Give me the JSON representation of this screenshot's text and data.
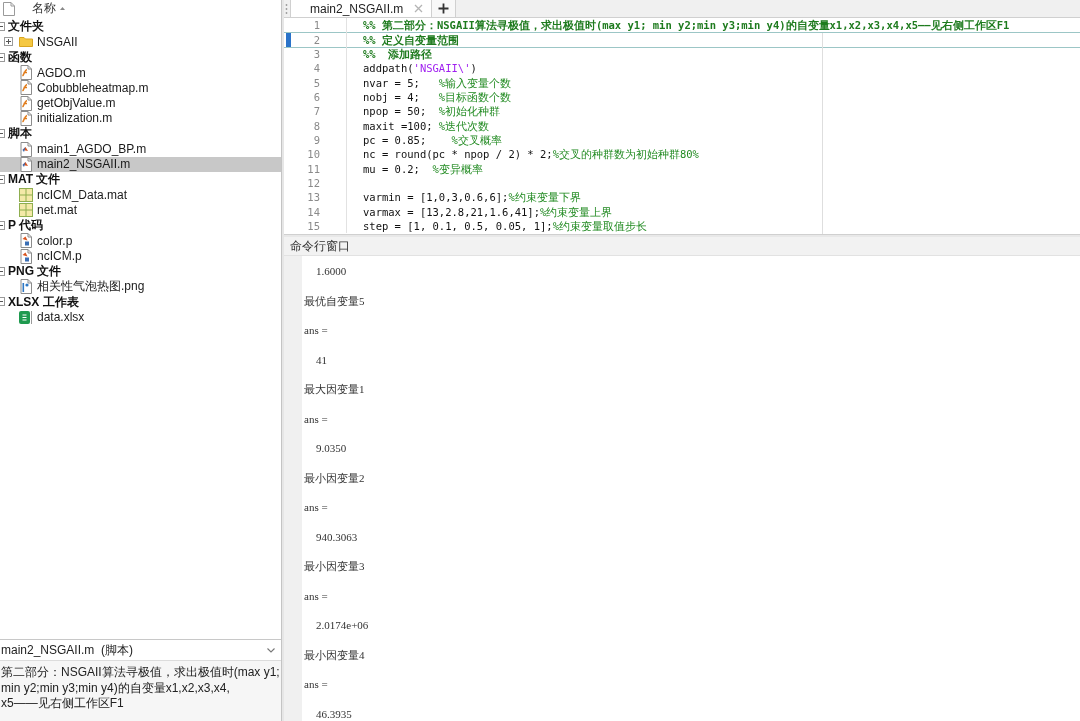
{
  "file_browser": {
    "column_header": "名称",
    "groups": [
      {
        "label": "文件夹",
        "expanded": true,
        "items": [
          {
            "name": "NSGAII",
            "kind": "folder",
            "expanded": false,
            "selected": false
          }
        ]
      },
      {
        "label": "函数",
        "expanded": true,
        "items": [
          {
            "name": "AGDO.m",
            "kind": "function",
            "selected": false
          },
          {
            "name": "Cobubbleheatmap.m",
            "kind": "function",
            "selected": false
          },
          {
            "name": "getObjValue.m",
            "kind": "function",
            "selected": false
          },
          {
            "name": "initialization.m",
            "kind": "function",
            "selected": false
          }
        ]
      },
      {
        "label": "脚本",
        "expanded": true,
        "items": [
          {
            "name": "main1_AGDO_BP.m",
            "kind": "script",
            "selected": false
          },
          {
            "name": "main2_NSGAII.m",
            "kind": "script",
            "selected": true
          }
        ]
      },
      {
        "label": "MAT 文件",
        "expanded": true,
        "items": [
          {
            "name": "ncICM_Data.mat",
            "kind": "mat",
            "selected": false
          },
          {
            "name": "net.mat",
            "kind": "mat",
            "selected": false
          }
        ]
      },
      {
        "label": "P 代码",
        "expanded": true,
        "items": [
          {
            "name": "color.p",
            "kind": "pcode",
            "selected": false
          },
          {
            "name": "ncICM.p",
            "kind": "pcode",
            "selected": false
          }
        ]
      },
      {
        "label": "PNG 文件",
        "expanded": true,
        "items": [
          {
            "name": "相关性气泡热图.png",
            "kind": "png",
            "selected": false
          }
        ]
      },
      {
        "label": "XLSX 工作表",
        "expanded": true,
        "items": [
          {
            "name": "data.xlsx",
            "kind": "xlsx",
            "selected": false
          }
        ]
      }
    ]
  },
  "details": {
    "title": "main2_NSGAII.m  (脚本)",
    "description_lines": [
      "第二部分：NSGAII算法寻极值，求出极值时(max y1;",
      "min y2;min y3;min y4)的自变量x1,x2,x3,x4,",
      "x5——见右侧工作区F1"
    ]
  },
  "editor": {
    "tabs": [
      {
        "label": "main2_NSGAII.m",
        "selected": true
      }
    ],
    "lines": [
      {
        "number": "1",
        "current": false,
        "segments": [
          {
            "kind": "section",
            "text": "%% 第二部分：NSGAII算法寻极值，求出极值时(max y1; min y2;min y3;min y4)的自变量x1,x2,x3,x4,x5——见右侧工作区F1"
          }
        ]
      },
      {
        "number": "2",
        "current": true,
        "segments": [
          {
            "kind": "section",
            "text": "%% 定义自变量范围"
          }
        ]
      },
      {
        "number": "3",
        "current": false,
        "segments": [
          {
            "kind": "section",
            "text": "%%  添加路径"
          }
        ]
      },
      {
        "number": "4",
        "current": false,
        "segments": [
          {
            "kind": "code",
            "text": "addpath("
          },
          {
            "kind": "string",
            "text": "'NSGAII\\'"
          },
          {
            "kind": "code",
            "text": ")"
          }
        ]
      },
      {
        "number": "5",
        "current": false,
        "segments": [
          {
            "kind": "code",
            "text": "nvar = 5;   "
          },
          {
            "kind": "comment",
            "text": "%输入变量个数"
          }
        ]
      },
      {
        "number": "6",
        "current": false,
        "segments": [
          {
            "kind": "code",
            "text": "nobj = 4;   "
          },
          {
            "kind": "comment",
            "text": "%目标函数个数"
          }
        ]
      },
      {
        "number": "7",
        "current": false,
        "segments": [
          {
            "kind": "code",
            "text": "npop = 50;  "
          },
          {
            "kind": "comment",
            "text": "%初始化种群"
          }
        ]
      },
      {
        "number": "8",
        "current": false,
        "segments": [
          {
            "kind": "code",
            "text": "maxit =100; "
          },
          {
            "kind": "comment",
            "text": "%迭代次数"
          }
        ]
      },
      {
        "number": "9",
        "current": false,
        "segments": [
          {
            "kind": "code",
            "text": "pc = 0.85;    "
          },
          {
            "kind": "comment",
            "text": "%交叉概率"
          }
        ]
      },
      {
        "number": "10",
        "current": false,
        "segments": [
          {
            "kind": "code",
            "text": "nc = round(pc * npop / 2) * 2;"
          },
          {
            "kind": "comment",
            "text": "%交叉的种群数为初始种群80%"
          }
        ]
      },
      {
        "number": "11",
        "current": false,
        "segments": [
          {
            "kind": "code",
            "text": "mu = 0.2;  "
          },
          {
            "kind": "comment",
            "text": "%变异概率"
          }
        ]
      },
      {
        "number": "12",
        "current": false
      },
      {
        "number": "13",
        "current": false,
        "segments": [
          {
            "kind": "code",
            "text": "varmin = [1,0,3,0.6,6];"
          },
          {
            "kind": "comment",
            "text": "%约束变量下界"
          }
        ]
      },
      {
        "number": "14",
        "current": false,
        "segments": [
          {
            "kind": "code",
            "text": "varmax = [13,2.8,21,1.6,41];"
          },
          {
            "kind": "comment",
            "text": "%约束变量上界"
          }
        ]
      },
      {
        "number": "15",
        "current": false,
        "segments": [
          {
            "kind": "code",
            "text": "step = [1, 0.1, 0.5, 0.05, 1];"
          },
          {
            "kind": "comment",
            "text": "%约束变量取值步长"
          }
        ]
      }
    ]
  },
  "command_window": {
    "title": "命令行窗口",
    "output": [
      {
        "kind": "value",
        "text": "1.6000"
      },
      {
        "kind": "text",
        "text": "最优自变量5"
      },
      {
        "kind": "text",
        "text": "ans ="
      },
      {
        "kind": "value",
        "text": "41"
      },
      {
        "kind": "text",
        "text": "最大因变量1"
      },
      {
        "kind": "text",
        "text": "ans ="
      },
      {
        "kind": "value",
        "text": "9.0350"
      },
      {
        "kind": "text",
        "text": "最小因变量2"
      },
      {
        "kind": "text",
        "text": "ans ="
      },
      {
        "kind": "value",
        "text": "940.3063"
      },
      {
        "kind": "text",
        "text": "最小因变量3"
      },
      {
        "kind": "text",
        "text": "ans ="
      },
      {
        "kind": "value",
        "text": "2.0174e+06"
      },
      {
        "kind": "text",
        "text": "最小因变量4"
      },
      {
        "kind": "text",
        "text": "ans ="
      },
      {
        "kind": "value",
        "text": "46.3935"
      }
    ]
  }
}
